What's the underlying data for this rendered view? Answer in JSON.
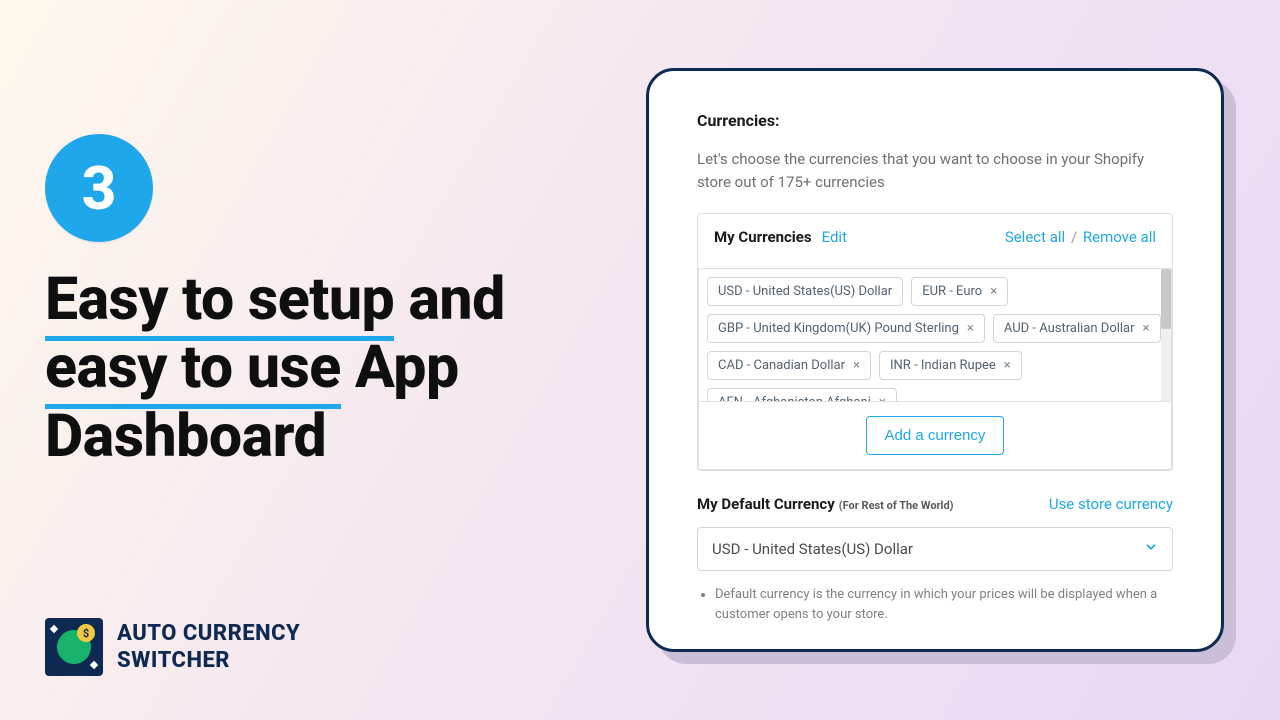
{
  "step": {
    "number": "3"
  },
  "headline": {
    "line1a": "Easy to setup",
    "line1b": "and",
    "line2a": "easy to use",
    "line2b": "App",
    "line3": "Dashboard"
  },
  "brand": {
    "line1": "AUTO CURRENCY",
    "line2": "SWITCHER",
    "coin": "$"
  },
  "panel": {
    "section_title": "Currencies:",
    "section_desc": "Let's choose the currencies that you want to choose in your Shopify store out of 175+ currencies",
    "my_currencies_title": "My Currencies",
    "edit": "Edit",
    "select_all": "Select all",
    "sep": "/",
    "remove_all": "Remove all",
    "chips": [
      {
        "label": "USD - United States(US) Dollar",
        "removable": false
      },
      {
        "label": "EUR - Euro",
        "removable": true
      },
      {
        "label": "GBP - United Kingdom(UK) Pound Sterling",
        "removable": true
      },
      {
        "label": "AUD - Australian Dollar",
        "removable": true
      },
      {
        "label": "CAD - Canadian Dollar",
        "removable": true
      },
      {
        "label": "INR - Indian Rupee",
        "removable": true
      },
      {
        "label": "AFN - Afghanistan Afghani",
        "removable": true
      }
    ],
    "add_currency": "Add a currency",
    "default_title": "My Default Currency",
    "default_sub": "(For Rest of The World)",
    "use_store_currency": "Use store currency",
    "default_selected": "USD - United States(US) Dollar",
    "note": "Default currency is the currency in which your prices will be displayed when a customer opens to your store."
  }
}
